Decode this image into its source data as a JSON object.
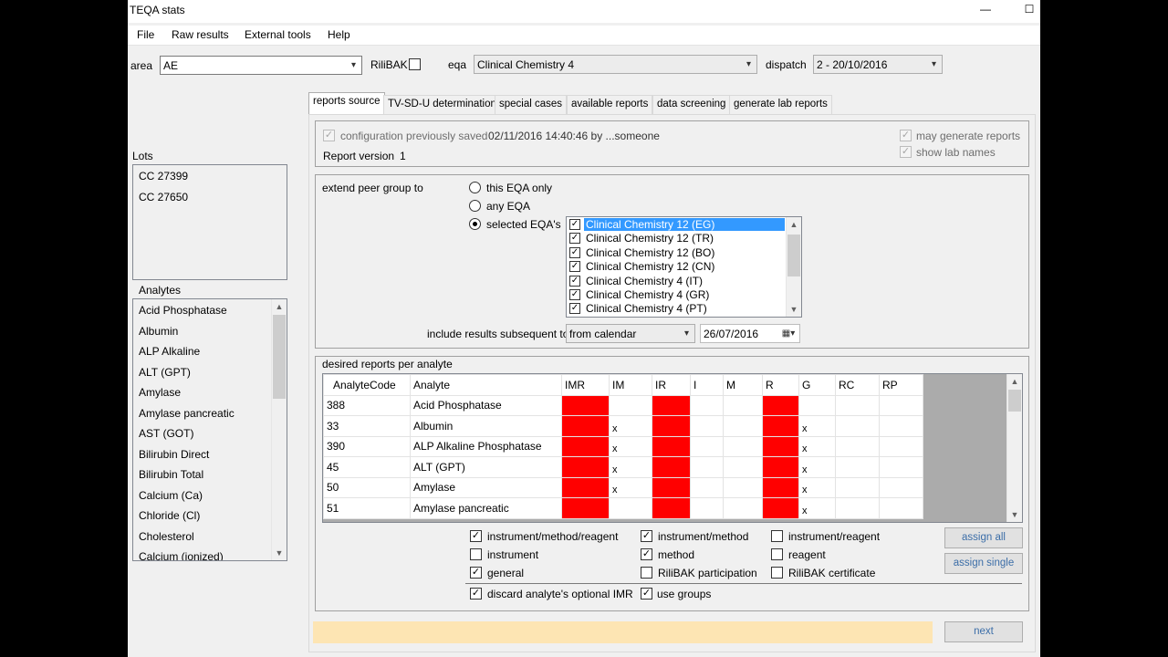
{
  "window": {
    "title": "TEQA stats",
    "minimize": "—",
    "maximize": "☐"
  },
  "menu": [
    "File",
    "Raw results",
    "External tools",
    "Help"
  ],
  "filters": {
    "area_label": "area",
    "area_value": "AE",
    "rilibak_label": "RiliBAK",
    "eqa_label": "eqa",
    "eqa_value": "Clinical Chemistry 4",
    "dispatch_label": "dispatch",
    "dispatch_value": "2 - 20/10/2016"
  },
  "left": {
    "lots_label": "Lots",
    "lots": [
      "CC 27399",
      "CC 27650"
    ],
    "analytes_label": "Analytes",
    "analytes": [
      "Acid Phosphatase",
      "Albumin",
      "ALP Alkaline",
      "ALT (GPT)",
      "Amylase",
      "Amylase pancreatic",
      "AST (GOT)",
      "Bilirubin Direct",
      "Bilirubin Total",
      "Calcium (Ca)",
      "Chloride (Cl)",
      "Cholesterol",
      "Calcium (ionized)"
    ]
  },
  "tabs": [
    "reports source",
    "TV-SD-U determination",
    "special cases",
    "available reports",
    "data screening",
    "generate lab reports"
  ],
  "config": {
    "saved_label": "configuration previously saved",
    "saved_info": "02/11/2016 14:40:46 by ...someone",
    "version_label": "Report version",
    "version_value": "1",
    "may_generate": "may generate reports",
    "show_lab_names": "show lab names"
  },
  "peer": {
    "label": "extend peer group to",
    "options": [
      "this EQA only",
      "any EQA",
      "selected EQA's"
    ],
    "selected_option": "selected EQA's",
    "eqa_list": [
      "Clinical Chemistry 12 (EG)",
      "Clinical Chemistry 12 (TR)",
      "Clinical Chemistry 12 (BO)",
      "Clinical Chemistry 12 (CN)",
      "Clinical Chemistry 4 (IT)",
      "Clinical Chemistry 4 (GR)",
      "Clinical Chemistry 4 (PT)"
    ],
    "include_label": "include results subsequent to",
    "include_value": "from calendar",
    "date_value": "26/07/2016"
  },
  "desired": {
    "label": "desired reports per analyte",
    "columns": [
      "AnalyteCode",
      "Analyte",
      "IMR",
      "IM",
      "IR",
      "I",
      "M",
      "R",
      "G",
      "RC",
      "RP"
    ],
    "rows": [
      {
        "code": "388",
        "analyte": "Acid Phosphatase",
        "im": "",
        "g": ""
      },
      {
        "code": "33",
        "analyte": "Albumin",
        "im": "x",
        "g": "x"
      },
      {
        "code": "390",
        "analyte": "ALP Alkaline Phosphatase",
        "im": "x",
        "g": "x"
      },
      {
        "code": "45",
        "analyte": "ALT (GPT)",
        "im": "x",
        "g": "x"
      },
      {
        "code": "50",
        "analyte": "Amylase",
        "im": "x",
        "g": "x"
      },
      {
        "code": "51",
        "analyte": "Amylase pancreatic",
        "im": "",
        "g": "x"
      }
    ],
    "red_columns": [
      "IMR",
      "IR",
      "R"
    ],
    "red_color": "#ff0000",
    "options": [
      {
        "label": "instrument/method/reagent",
        "checked": true
      },
      {
        "label": "instrument/method",
        "checked": true
      },
      {
        "label": "instrument/reagent",
        "checked": false
      },
      {
        "label": "instrument",
        "checked": false
      },
      {
        "label": "method",
        "checked": true
      },
      {
        "label": "reagent",
        "checked": false
      },
      {
        "label": "general",
        "checked": true
      },
      {
        "label": "RiliBAK participation",
        "checked": false
      },
      {
        "label": "RiliBAK certificate",
        "checked": false
      }
    ],
    "discard_label": "discard analyte's optional IMR",
    "use_groups_label": "use groups",
    "assign_all": "assign all",
    "assign_single": "assign single"
  },
  "footer": {
    "status_text": "",
    "status_color": "#fde5b3",
    "next_label": "next"
  }
}
